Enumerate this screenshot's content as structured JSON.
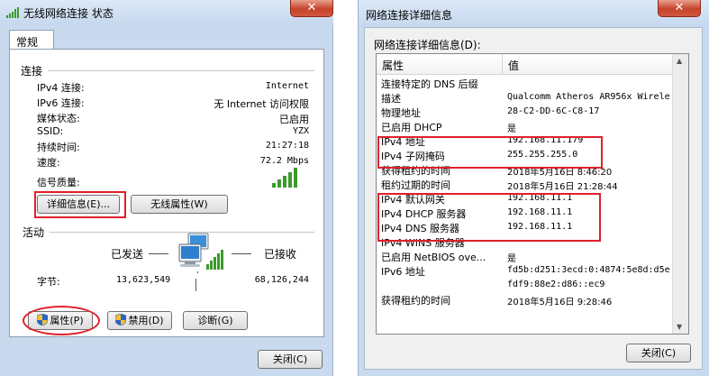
{
  "status_window": {
    "title": "无线网络连接 状态",
    "close_glyph": "✕",
    "tab": "常规",
    "connection": {
      "section_title": "连接",
      "rows": [
        {
          "label": "IPv4 连接:",
          "value": "Internet"
        },
        {
          "label": "IPv6 连接:",
          "value": "无 Internet 访问权限"
        },
        {
          "label": "媒体状态:",
          "value": "已启用"
        },
        {
          "label": "SSID:",
          "value": "YZX"
        },
        {
          "label": "持续时间:",
          "value": "21:27:18"
        },
        {
          "label": "速度:",
          "value": "72.2 Mbps"
        }
      ],
      "signal_label": "信号质量:",
      "signal_bars": 5,
      "details_button": "详细信息(E)...",
      "wireless_props_button": "无线属性(W)"
    },
    "activity": {
      "section_title": "活动",
      "sent_label": "已发送",
      "received_label": "已接收",
      "bytes_label": "字节:",
      "bytes_sent": "13,623,549",
      "bytes_received": "68,126,244"
    },
    "buttons": {
      "properties": "属性(P)",
      "disable": "禁用(D)",
      "diagnose": "诊断(G)",
      "close": "关闭(C)"
    },
    "highlight_color": "#e0202a"
  },
  "details_window": {
    "title": "网络连接详细信息",
    "close_glyph": "✕",
    "list_label": "网络连接详细信息(D):",
    "col_property": "属性",
    "col_value": "值",
    "rows": [
      {
        "p": "连接特定的 DNS 后缀",
        "v": ""
      },
      {
        "p": "描述",
        "v": "Qualcomm Atheros AR956x Wirele"
      },
      {
        "p": "物理地址",
        "v": "28-C2-DD-6C-C8-17"
      },
      {
        "p": "已启用 DHCP",
        "v": "是"
      },
      {
        "p": "IPv4 地址",
        "v": "192.168.11.179"
      },
      {
        "p": "IPv4 子网掩码",
        "v": "255.255.255.0"
      },
      {
        "p": "获得租约的时间",
        "v": "2018年5月16日 8:46:20"
      },
      {
        "p": "租约过期的时间",
        "v": "2018年5月16日 21:28:44"
      },
      {
        "p": "IPv4 默认网关",
        "v": "192.168.11.1"
      },
      {
        "p": "IPv4 DHCP 服务器",
        "v": "192.168.11.1"
      },
      {
        "p": "IPv4 DNS 服务器",
        "v": "192.168.11.1"
      },
      {
        "p": "IPv4 WINS 服务器",
        "v": ""
      },
      {
        "p": "已启用 NetBIOS ove...",
        "v": "是"
      },
      {
        "p": "IPv6 地址",
        "v": "fd5b:d251:3ecd:0:4874:5e8d:d5e"
      },
      {
        "p": "",
        "v": "fdf9:88e2:d86::ec9"
      },
      {
        "p": "获得租约的时间",
        "v": "2018年5月16日 9:28:46"
      }
    ],
    "close_button": "关闭(C)"
  }
}
